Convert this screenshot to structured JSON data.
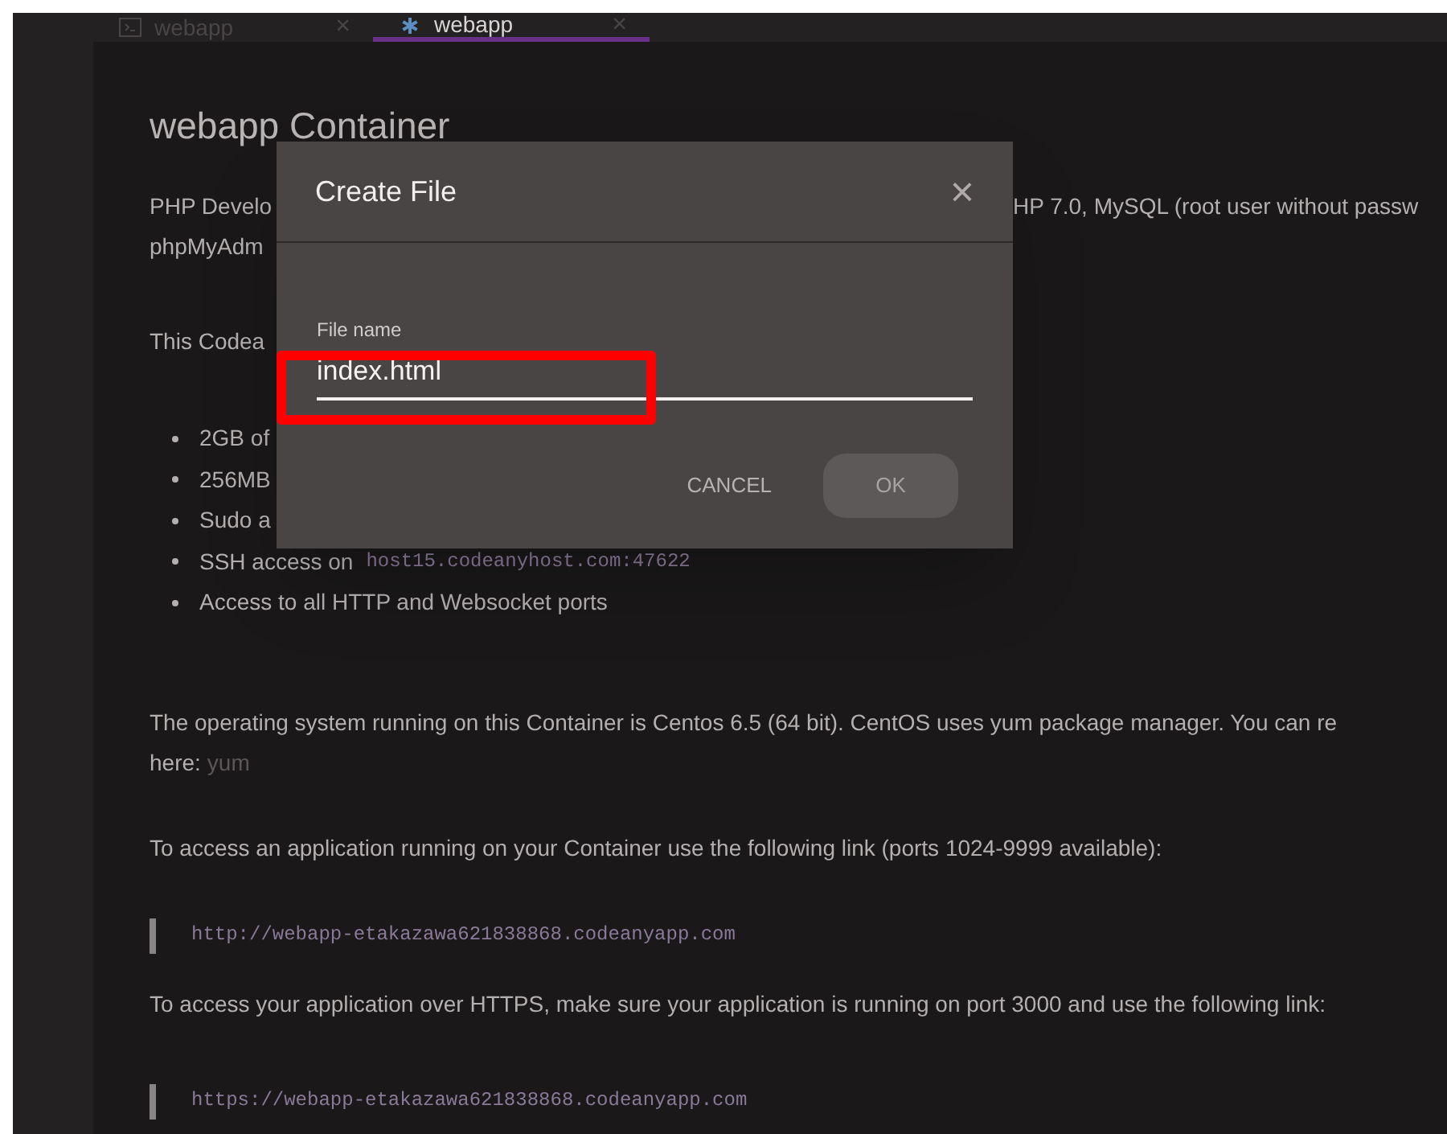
{
  "tabs": [
    {
      "label": "webapp",
      "close": "×",
      "selected": false,
      "kind": "terminal"
    },
    {
      "label": "webapp",
      "close": "×",
      "selected": true,
      "kind": "readme"
    }
  ],
  "document": {
    "title": "webapp Container",
    "intro": {
      "left": "PHP Develo",
      "right": "HP 7.0, MySQL (root user without passw",
      "line2": "phpMyAdm"
    },
    "note": "This Codea",
    "features": [
      {
        "text": "2GB of"
      },
      {
        "text": "256MB"
      },
      {
        "text": "Sudo a"
      },
      {
        "text": "SSH access on",
        "code": "host15.codeanyhost.com:47622"
      },
      {
        "text": "Access to all HTTP and Websocket ports"
      }
    ],
    "os": {
      "line1": "The operating system running on this Container is Centos 6.5 (64 bit). CentOS uses yum package manager. You can re",
      "line2": "here:",
      "link": "yum"
    },
    "http_text": "To access an application running on your Container use the following link (ports 1024-9999 available):",
    "http_url": "http://webapp-etakazawa621838868.codeanyapp.com",
    "https_text": "To access your application over HTTPS, make sure your application is running on port 3000 and use the following link:",
    "https_url": "https://webapp-etakazawa621838868.codeanyapp.com"
  },
  "dialog": {
    "title": "Create File",
    "close": "×",
    "field": {
      "label": "File name",
      "value": "index.html"
    },
    "buttons": [
      {
        "label": "CANCEL",
        "kind": "text"
      },
      {
        "label": "OK",
        "kind": "raised"
      }
    ]
  }
}
